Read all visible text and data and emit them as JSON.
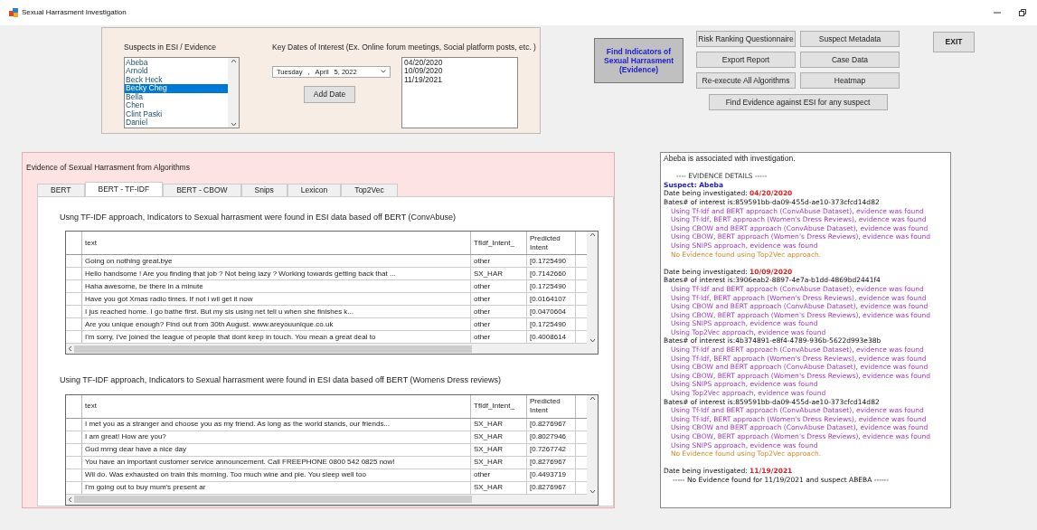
{
  "window": {
    "title": "Sexual Harrasment Investigation"
  },
  "suspects": {
    "label": "Suspects in ESI / Evidence",
    "items": [
      {
        "name": "Abeba",
        "selected": false
      },
      {
        "name": "Arnold",
        "selected": false
      },
      {
        "name": "Beck Heck",
        "selected": false
      },
      {
        "name": "Becky Cheg",
        "selected": true
      },
      {
        "name": "Bella",
        "selected": false
      },
      {
        "name": "Chen",
        "selected": false
      },
      {
        "name": "Clint Paski",
        "selected": false
      },
      {
        "name": "Daniel",
        "selected": false
      }
    ]
  },
  "key_dates": {
    "label": "Key Dates of Interest (Ex. Online forum meetings, Social platform posts, etc. )",
    "date_picker": [
      "Tuesday",
      ",",
      "April",
      "5, 2022"
    ],
    "add_button": "Add Date",
    "dates": [
      "04/20/2020",
      "10/09/2020",
      "11/19/2021"
    ]
  },
  "find_indicators_button": "Find Indicators of Sexual Harrasment (Evidence)",
  "buttons": [
    "Risk Ranking Questionnaire",
    "Suspect Metadata",
    "Export Report",
    "Case Data",
    "Re-execute All Algorithms",
    "Heatmap"
  ],
  "find_evidence_button": "Find Evidence against ESI for any suspect",
  "exit_button": "EXIT",
  "evidence_panel": {
    "title": "Evidence of Sexual Harrasment from Algorithms",
    "tabs": [
      {
        "label": "BERT",
        "selected": false
      },
      {
        "label": "BERT - TF-IDF",
        "selected": true
      },
      {
        "label": "BERT - CBOW",
        "selected": false
      },
      {
        "label": "Snips",
        "selected": false
      },
      {
        "label": "Lexicon",
        "selected": false
      },
      {
        "label": "Top2Vec",
        "selected": false
      }
    ],
    "tables": [
      {
        "caption": "Usng TF-IDF approach, Indicators to Sexual harrasment were found in ESI data based off BERT (ConvAbuse)",
        "columns": [
          "text",
          "TfIdf_Intent_",
          "Predicted Intent"
        ],
        "rows": [
          [
            "Going on nothing great.bye",
            "other",
            "[0.1725490"
          ],
          [
            "Hello handsome ! Are you finding that job ? Not being lazy ? Working towards getting back that ...",
            "SX_HAR",
            "[0.7142660"
          ],
          [
            "Haha awesome, be there in a minute",
            "other",
            "[0.1725490"
          ],
          [
            "Have you got Xmas radio times. If not i wil get it now",
            "other",
            "[0.0164107"
          ],
          [
            "I jus reached home. I go bathe first. But my sis using net tell u when she finishes k...",
            "other",
            "[0.0470604"
          ],
          [
            "Are you unique enough? Find out from 30th August. www.areyouunique.co.uk",
            "other",
            "[0.1725490"
          ],
          [
            "I'm sorry, I've joined the league of people that dont keep in touch. You mean a great deal to",
            "other",
            "[0.4008614"
          ]
        ]
      },
      {
        "caption": "Using TF-IDF approach, Indicators to Sexual harrasment were found in ESI data based off BERT (Womens Dress reviews)",
        "columns": [
          "text",
          "TfIdf_Intent_",
          "Predicted Intent"
        ],
        "rows": [
          [
            "I met you as a stranger and choose you as my friend. As long as the world stands, our friends...",
            "SX_HAR",
            "[0.8276967"
          ],
          [
            "I am great! How are you?",
            "SX_HAR",
            "[0.8027946"
          ],
          [
            "Gud mrng dear have a nice day",
            "SX_HAR",
            "[0.7267742"
          ],
          [
            "You have an important customer service announcement. Call FREEPHONE 0800 542 0825 now!",
            "SX_HAR",
            "[0.8276967"
          ],
          [
            "Wil do. Was exhausted on train this morning. Too much wine and pie. You sleep well too",
            "other",
            "[0.4493719"
          ],
          [
            "I'm going out to buy mum's present ar",
            "SX_HAR",
            "[0.8276967"
          ]
        ]
      }
    ]
  },
  "log": [
    {
      "kind": "plain",
      "text": "Abeba is associated with investigation."
    },
    {
      "kind": "blank"
    },
    {
      "kind": "heading",
      "text": "---- EVIDENCE DETAILS -----"
    },
    {
      "kind": "suspect",
      "text": "Suspect: Abeba"
    },
    {
      "kind": "date",
      "text": "Date being investigated:",
      "value": "04/20/2020"
    },
    {
      "kind": "bates",
      "text": "Bates# of interest is:859591bb-da09-455d-ae10-373cfcd14d82"
    },
    {
      "kind": "found",
      "text": "Using Tf-Idf and BERT approach (ConvAbuse Dataset), evidence was found"
    },
    {
      "kind": "found",
      "text": "Using Tf-Idf, BERT approach (Women's Dress Reviews), evidence was found"
    },
    {
      "kind": "found",
      "text": "Using CBOW and BERT approach (ConvAbuse Dataset), evidence was found"
    },
    {
      "kind": "found",
      "text": "Using CBOW, BERT approach (Women's Dress Reviews), evidence was found"
    },
    {
      "kind": "found",
      "text": "Using SNIPS approach, evidence was found"
    },
    {
      "kind": "not_found",
      "text": "No Evidence found using Top2Vec approach."
    },
    {
      "kind": "blank"
    },
    {
      "kind": "date",
      "text": "Date being investigated:",
      "value": "10/09/2020"
    },
    {
      "kind": "bates",
      "text": "Bates# of interest is:3906eab2-8897-4e7a-b1dd-4869bd2441f4"
    },
    {
      "kind": "found",
      "text": "Using Tf-Idf and BERT approach (ConvAbuse Dataset), evidence was found"
    },
    {
      "kind": "found",
      "text": "Using Tf-Idf, BERT approach (Women's Dress Reviews), evidence was found"
    },
    {
      "kind": "found",
      "text": "Using CBOW and BERT approach (ConvAbuse Dataset), evidence was found"
    },
    {
      "kind": "found",
      "text": "Using CBOW, BERT approach (Women's Dress Reviews), evidence was found"
    },
    {
      "kind": "found",
      "text": "Using SNIPS approach, evidence was found"
    },
    {
      "kind": "found",
      "text": "Using Top2Vec approach, evidence was found"
    },
    {
      "kind": "bates",
      "text": "Bates# of interest is:4b374891-e8f4-4789-936b-5622d993e38b"
    },
    {
      "kind": "found",
      "text": "Using Tf-Idf and BERT approach (ConvAbuse Dataset), evidence was found"
    },
    {
      "kind": "found",
      "text": "Using Tf-Idf, BERT approach (Women's Dress Reviews), evidence was found"
    },
    {
      "kind": "found",
      "text": "Using CBOW and BERT approach (ConvAbuse Dataset), evidence was found"
    },
    {
      "kind": "found",
      "text": "Using CBOW, BERT approach (Women's Dress Reviews), evidence was found"
    },
    {
      "kind": "found",
      "text": "Using SNIPS approach, evidence was found"
    },
    {
      "kind": "found",
      "text": "Using Top2Vec approach, evidence was found"
    },
    {
      "kind": "bates",
      "text": "Bates# of interest is:859591bb-da09-455d-ae10-373cfcd14d82"
    },
    {
      "kind": "found",
      "text": "Using Tf-Idf and BERT approach (ConvAbuse Dataset), evidence was found"
    },
    {
      "kind": "found",
      "text": "Using Tf-Idf, BERT approach (Women's Dress Reviews), evidence was found"
    },
    {
      "kind": "found",
      "text": "Using CBOW and BERT approach (ConvAbuse Dataset), evidence was found"
    },
    {
      "kind": "found",
      "text": "Using CBOW, BERT approach (Women's Dress Reviews), evidence was found"
    },
    {
      "kind": "found",
      "text": "Using SNIPS approach, evidence was found"
    },
    {
      "kind": "not_found",
      "text": "No Evidence found using Top2Vec approach."
    },
    {
      "kind": "blank"
    },
    {
      "kind": "date",
      "text": "Date being investigated:",
      "value": "11/19/2021"
    },
    {
      "kind": "closing",
      "text": "----- No Evidence found for 11/19/2021 and suspect ABEBA ------"
    }
  ]
}
